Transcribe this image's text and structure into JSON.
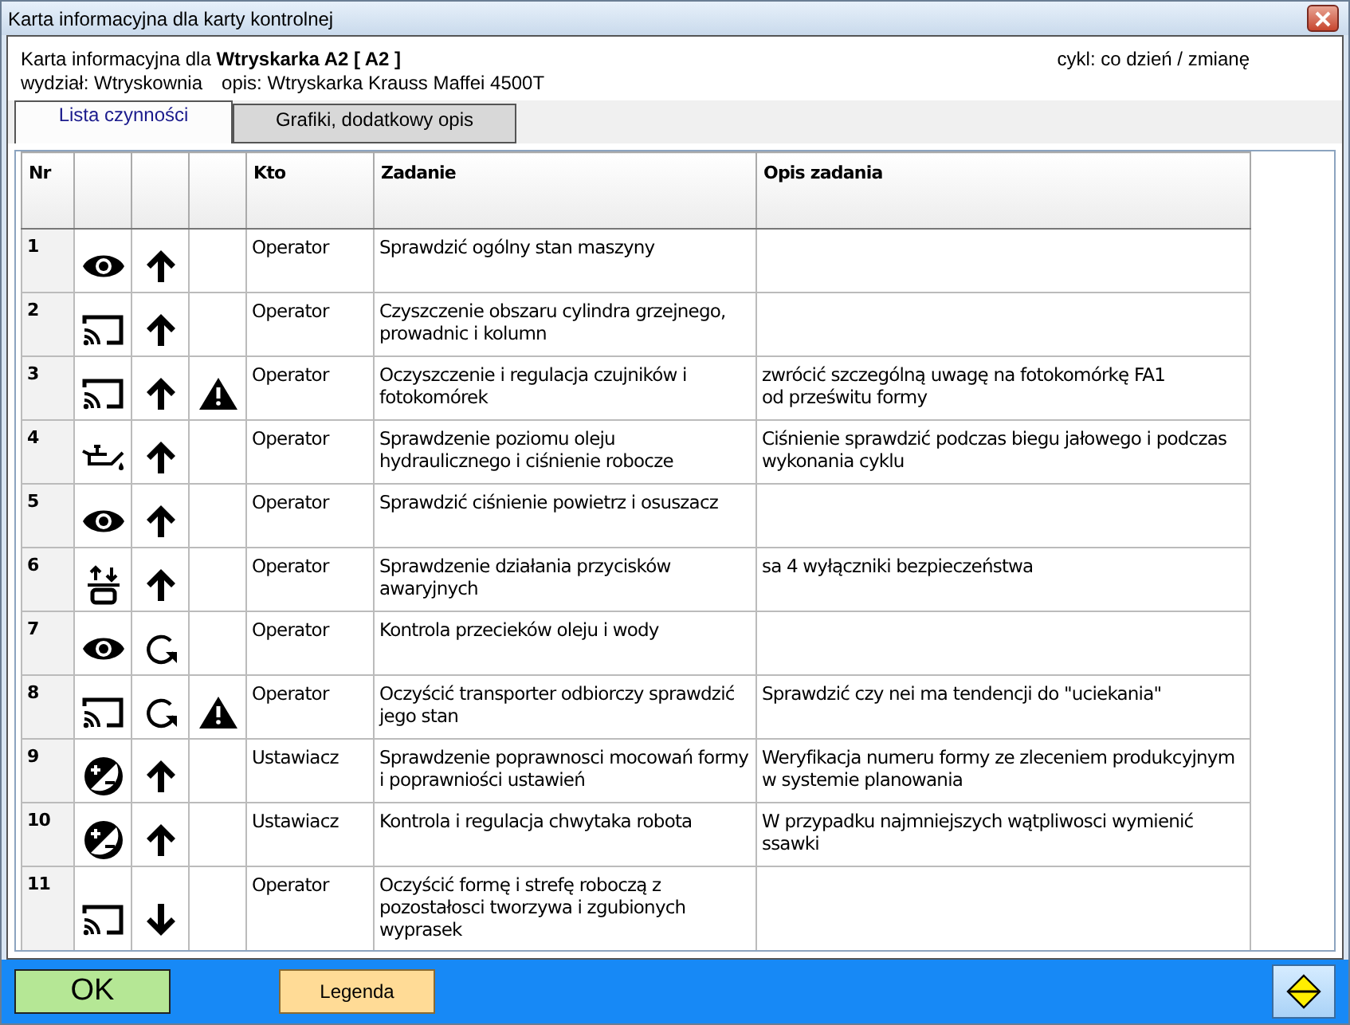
{
  "window": {
    "title": "Karta informacyjna dla karty kontrolnej"
  },
  "header": {
    "prefix": "Karta informacyjna dla",
    "machine": "Wtryskarka A2  [ A2 ]",
    "cycle": "cykl: co dzień / zmianę",
    "department": "wydział: Wtryskownia",
    "description": "opis: Wtryskarka Krauss Maffei 4500T"
  },
  "tabs": [
    {
      "label": "Lista czynności",
      "selected": true
    },
    {
      "label": "Grafiki, dodatkowy opis",
      "selected": false
    }
  ],
  "table": {
    "columns": [
      "Nr",
      "Kto",
      "Zadanie",
      "Opis zadania"
    ],
    "rows": [
      {
        "nr": "1",
        "symbols": [
          {
            "kind": "look"
          },
          {
            "kind": "up"
          }
        ],
        "who": "Operator",
        "task": "Sprawdzić ogólny stan maszyny",
        "note": ""
      },
      {
        "nr": "2",
        "symbols": [
          {
            "kind": "clean"
          },
          {
            "kind": "up"
          }
        ],
        "who": "Operator",
        "task": "Czyszczenie obszaru cylindra grzejnego, prowadnic i kolumn",
        "note": ""
      },
      {
        "nr": "3",
        "symbols": [
          {
            "kind": "clean"
          },
          {
            "kind": "up"
          },
          {
            "kind": "warning"
          }
        ],
        "who": "Operator",
        "task": "Oczyszczenie i regulacja czujników i fotokomórek",
        "note": "zwrócić szczególną uwagę na fotokomórkę FA1\nod prześwitu formy"
      },
      {
        "nr": "4",
        "symbols": [
          {
            "kind": "oil"
          },
          {
            "kind": "up"
          }
        ],
        "who": "Operator",
        "task": "Sprawdzenie poziomu oleju hydraulicznego i ciśnienie robocze",
        "note": "Ciśnienie sprawdzić podczas biegu jałowego i podczas wykonania cyklu"
      },
      {
        "nr": "5",
        "symbols": [
          {
            "kind": "look"
          },
          {
            "kind": "up"
          }
        ],
        "who": "Operator",
        "task": "Sprawdzić ciśnienie powietrz i osuszacz",
        "note": ""
      },
      {
        "nr": "6",
        "symbols": [
          {
            "kind": "buttons"
          },
          {
            "kind": "up"
          }
        ],
        "who": "Operator",
        "task": "Sprawdzenie działania przycisków awaryjnych",
        "note": "sa 4 wyłączniki bezpieczeństwa"
      },
      {
        "nr": "7",
        "symbols": [
          {
            "kind": "look"
          },
          {
            "kind": "cycle"
          }
        ],
        "who": "Operator",
        "task": "Kontrola przecieków oleju i wody",
        "note": ""
      },
      {
        "nr": "8",
        "symbols": [
          {
            "kind": "clean"
          },
          {
            "kind": "cycle"
          },
          {
            "kind": "warning"
          }
        ],
        "who": "Operator",
        "task": "Oczyścić transporter odbiorczy  sprawdzić jego stan",
        "note": "Sprawdzić czy nei ma tendencji do \"uciekania\""
      },
      {
        "nr": "9",
        "symbols": [
          {
            "kind": "adjust"
          },
          {
            "kind": "up"
          }
        ],
        "who": "Ustawiacz",
        "task": "Sprawdzenie poprawnosci mocowań formy i poprawniości ustawień",
        "note": "Weryfikacja numeru formy ze zleceniem produkcyjnym w systemie planowania"
      },
      {
        "nr": "10",
        "symbols": [
          {
            "kind": "adjust"
          },
          {
            "kind": "up"
          }
        ],
        "who": "Ustawiacz",
        "task": "Kontrola i regulacja chwytaka robota",
        "note": "W przypadku najmniejszych wątpliwosci wymienić ssawki"
      },
      {
        "nr": "11",
        "symbols": [
          {
            "kind": "clean"
          },
          {
            "kind": "down"
          }
        ],
        "who": "Operator",
        "task": "Oczyścić formę i strefę roboczą z pozostałosci tworzywa i zgubionych wyprasek",
        "note": ""
      }
    ]
  },
  "buttons": {
    "ok": "OK",
    "legend": "Legenda"
  }
}
